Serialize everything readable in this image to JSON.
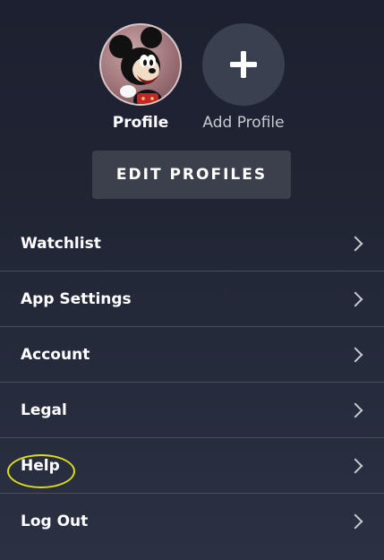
{
  "profiles": [
    {
      "label": "Profile",
      "avatar": "mickey-mouse-avatar-icon"
    },
    {
      "label": "Add Profile",
      "avatar": "plus-icon"
    }
  ],
  "edit_profiles_label": "EDIT PROFILES",
  "menu": {
    "items": [
      {
        "label": "Watchlist"
      },
      {
        "label": "App Settings"
      },
      {
        "label": "Account"
      },
      {
        "label": "Legal"
      },
      {
        "label": "Help"
      },
      {
        "label": "Log Out"
      }
    ]
  },
  "colors": {
    "background_top": "#1d2030",
    "background_bottom": "#2b3042",
    "button_bg": "#3c404c",
    "divider": "#4b4f5c",
    "highlight_ring": "#dcdc1e"
  }
}
